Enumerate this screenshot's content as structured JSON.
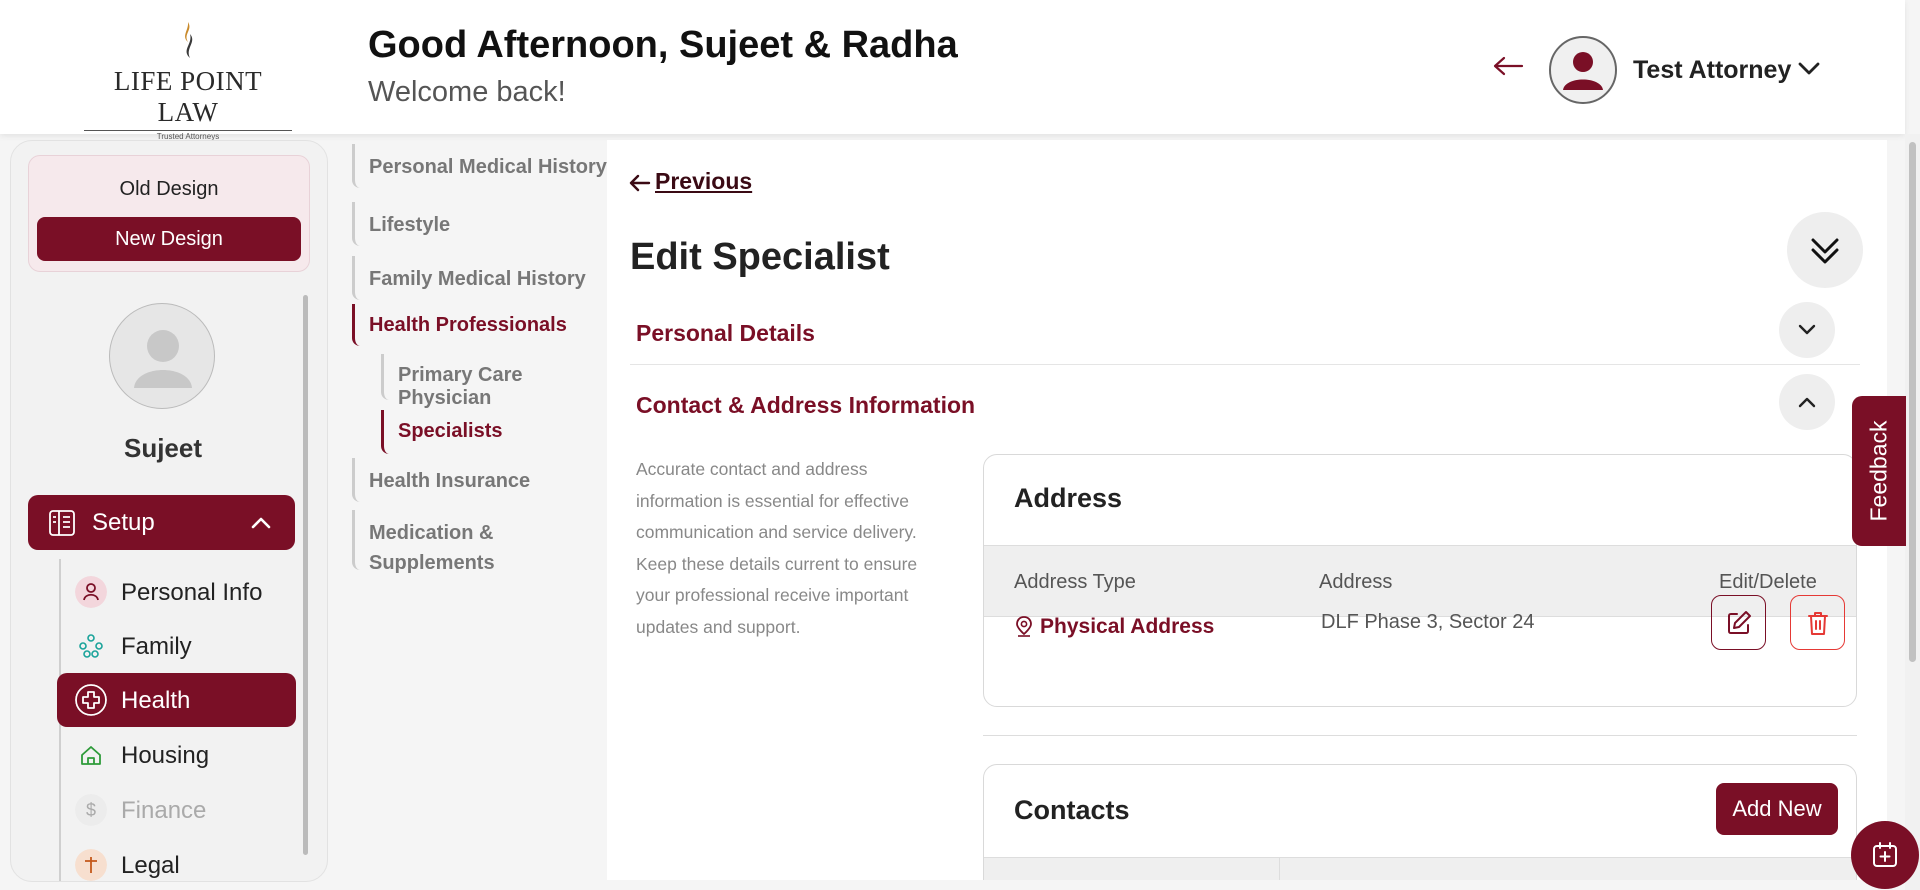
{
  "header": {
    "logo_text": "LIFE POINT LAW",
    "logo_sub": "Trusted Attorneys",
    "greeting": "Good Afternoon, Sujeet & Radha",
    "welcome": "Welcome back!",
    "user_name": "Test Attorney"
  },
  "sidebar": {
    "old_design": "Old Design",
    "new_design": "New Design",
    "profile_name": "Sujeet",
    "setup_label": "Setup",
    "items": [
      {
        "label": "Personal Info",
        "icon": "person-icon"
      },
      {
        "label": "Family",
        "icon": "family-icon"
      },
      {
        "label": "Health",
        "icon": "health-cross-icon",
        "active": true
      },
      {
        "label": "Housing",
        "icon": "home-icon"
      },
      {
        "label": "Finance",
        "icon": "dollar-icon",
        "disabled": true
      },
      {
        "label": "Legal",
        "icon": "legal-icon"
      }
    ]
  },
  "subnav": {
    "items": [
      {
        "label": "Personal Medical History"
      },
      {
        "label": "Lifestyle"
      },
      {
        "label": "Family Medical History"
      },
      {
        "label": "Health Professionals",
        "active": true
      },
      {
        "label": "Primary Care Physician"
      },
      {
        "label": "Specialists",
        "active": true
      },
      {
        "label": "Health Insurance"
      },
      {
        "label": "Medication &"
      },
      {
        "label": "Supplements"
      }
    ]
  },
  "main": {
    "previous_label": "Previous",
    "title": "Edit Specialist",
    "sections": [
      {
        "title": "Personal Details",
        "expanded": false
      },
      {
        "title": "Contact & Address Information",
        "expanded": true
      }
    ],
    "description": "Accurate contact and address information is essential for effective communication and service delivery. Keep these details current to ensure your professional receive important updates and support.",
    "address_card": {
      "title": "Address",
      "columns": [
        "Address Type",
        "Address",
        "Edit/Delete"
      ],
      "rows": [
        {
          "type": "Physical Address",
          "address": "DLF Phase 3, Sector 24"
        }
      ]
    },
    "contacts_card": {
      "title": "Contacts",
      "add_new_label": "Add New"
    }
  },
  "feedback_label": "Feedback",
  "colors": {
    "accent": "#7a0f26",
    "danger": "#e53935"
  }
}
